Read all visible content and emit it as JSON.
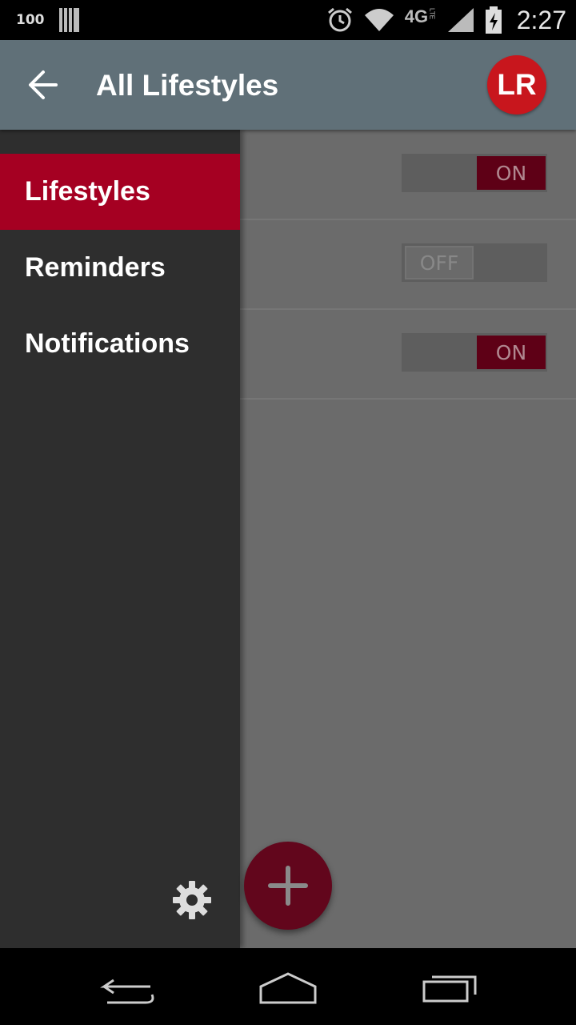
{
  "status_bar": {
    "signal_strength_text": "100",
    "network_label": "4G",
    "network_sub_label": "LTE",
    "time": "2:27",
    "icons": [
      "carrier-bars-icon",
      "alarm-icon",
      "wifi-icon",
      "signal-icon",
      "battery-charging-icon"
    ]
  },
  "app_bar": {
    "title": "All Lifestyles",
    "back_icon": "arrow-left-icon",
    "avatar_initials": "LR",
    "avatar_color": "#c8161d"
  },
  "drawer": {
    "items": [
      {
        "label": "Lifestyles",
        "active": true
      },
      {
        "label": "Reminders",
        "active": false
      },
      {
        "label": "Notifications",
        "active": false
      }
    ],
    "settings_icon": "gear-icon",
    "accent_color": "#a50022"
  },
  "content": {
    "toggles": [
      {
        "state": "ON"
      },
      {
        "state": "OFF"
      },
      {
        "state": "ON"
      }
    ]
  },
  "fab": {
    "icon": "plus-icon"
  },
  "nav_bar": {
    "icons": [
      "back-nav-icon",
      "home-nav-icon",
      "recents-nav-icon"
    ]
  }
}
